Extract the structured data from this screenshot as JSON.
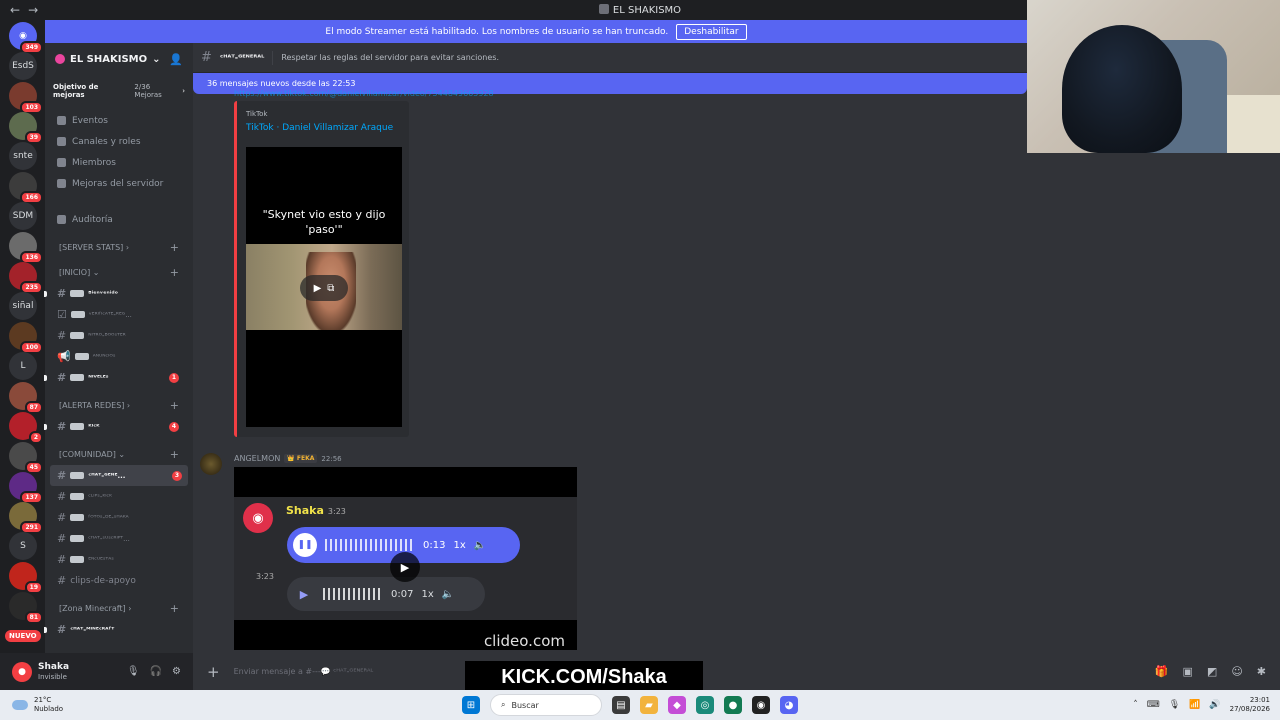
{
  "window": {
    "title": "EL SHAKISMO",
    "back": "←",
    "forward": "→"
  },
  "banner": {
    "text": "El modo Streamer está habilitado. Los nombres de usuario se han truncado.",
    "button": "Deshabilitar"
  },
  "rail": {
    "items": [
      {
        "kind": "icon",
        "label": "",
        "badge": "349"
      },
      {
        "kind": "text",
        "label": "EsdS",
        "badge": ""
      },
      {
        "kind": "img",
        "label": "",
        "badge": "103"
      },
      {
        "kind": "img",
        "label": "",
        "badge": "39"
      },
      {
        "kind": "text",
        "label": "snte",
        "badge": ""
      },
      {
        "kind": "img",
        "label": "",
        "badge": "166"
      },
      {
        "kind": "text",
        "label": "SDM",
        "badge": ""
      },
      {
        "kind": "img",
        "label": "",
        "badge": "136"
      },
      {
        "kind": "img",
        "label": "",
        "badge": "235"
      },
      {
        "kind": "text",
        "label": "siñal",
        "badge": ""
      },
      {
        "kind": "img",
        "label": "",
        "badge": "100"
      },
      {
        "kind": "text",
        "label": "L",
        "badge": ""
      },
      {
        "kind": "img",
        "label": "",
        "badge": "87"
      },
      {
        "kind": "img",
        "label": "",
        "badge": "2"
      },
      {
        "kind": "img",
        "label": "",
        "badge": "45"
      },
      {
        "kind": "img",
        "label": "",
        "badge": "137"
      },
      {
        "kind": "img",
        "label": "",
        "badge": "291"
      },
      {
        "kind": "text",
        "label": "S",
        "badge": ""
      },
      {
        "kind": "img",
        "label": "",
        "badge": "19"
      },
      {
        "kind": "img",
        "label": "",
        "badge": "81"
      }
    ],
    "new_label": "NUEVO"
  },
  "server": {
    "name": "EL SHAKISMO",
    "boost_label": "Objetivo de mejoras",
    "boost_count": "2/36 Mejoras",
    "links": [
      "Eventos",
      "Canales y roles",
      "Miembros",
      "Mejoras del servidor"
    ],
    "audit": "Auditoría"
  },
  "categories": {
    "server_stats": "[SERVER STATS]",
    "inicio": "[INICIO]",
    "alerta": "[ALERTA REDES]",
    "comunidad": "[COMUNIDAD]",
    "minecraft": "[Zona Minecraft]"
  },
  "channels": {
    "bienvenido": {
      "name": "ᴮⁱᵉⁿᵛᵉⁿⁱᵈᵒ",
      "badge": ""
    },
    "verificate": {
      "name": "ᵛᴱᴿᴵᶠᴵᶜᴬᵀᴱ-ᴿᴱᴳ...",
      "badge": ""
    },
    "nitro": {
      "name": "ᴺᴵᵀᴿᴼ-ᴮᴼᴼˢᵀᴱᴿ",
      "badge": ""
    },
    "anuncios": {
      "name": "ᴬᴺᵁᴺᶜᴵᴼˢ",
      "badge": ""
    },
    "niveles": {
      "name": "ᴺᴵⱽᴱᴸᴱˢ",
      "badge": "1"
    },
    "kick": {
      "name": "ᴷᴵᶜᴷ",
      "badge": "4"
    },
    "chat_general": {
      "name": "ᶜᴴᴬᵀ-ᴳᴱᴺᴱ...",
      "badge": "3"
    },
    "clips_kick": {
      "name": "ᶜᴸᴵᴾˢ-ᴷᴵᶜᴷ",
      "badge": ""
    },
    "fotos": {
      "name": "ᶠᴼᵀᴼˢ-ᴰᴱ-ˢᴴᴬᴷᴬ",
      "badge": ""
    },
    "chat_suscript": {
      "name": "ᶜᴴᴬᵀ-ˢᵁˢᶜᴿᴵᴾᵀ...",
      "badge": ""
    },
    "encuestas": {
      "name": "ᴱᴺᶜᵁᴱˢᵀᴬˢ",
      "badge": ""
    },
    "clips_apoyo": {
      "name": "clips-de-apoyo",
      "badge": ""
    },
    "chat_minecraft": {
      "name": "ᶜᴴᴬᵀ-ᴹᴵᴺᴱᶜᴿᴬᶠᵀ",
      "badge": ""
    }
  },
  "user": {
    "name": "Shaka",
    "status": "Invisible"
  },
  "header": {
    "channel": "ᶜᴴᴬᵀ-ᴳᴱᴺᴱᴿᴬᴸ",
    "topic": "Respetar las reglas del servidor para evitar sanciones."
  },
  "new_messages": "36 mensajes nuevos desde las 22:53",
  "embed": {
    "url": "https://www.tiktok.com/@danielvillamizar/video/7544849665928",
    "provider": "TikTok",
    "title": "TikTok · Daniel Villamizar Araque",
    "caption": "\"Skynet vio esto y dijo 'paso'\""
  },
  "message2": {
    "author": "ANGELMON",
    "tag": "FEKA",
    "time": "22:56",
    "video": {
      "sender": "Shaka",
      "sender_time": "3:23",
      "vm1_time": "0:13",
      "vm1_speed": "1x",
      "side_time": "3:23",
      "vm2_time": "0:07",
      "vm2_speed": "1x",
      "watermark": "clideo.com"
    }
  },
  "composer": {
    "placeholder": "Enviar mensaje a #---💬 ᶜᴴᴬᵀ-ᴳᴱᴺᴱᴿᴬᴸ"
  },
  "overlay": {
    "kick": "KICK.COM/Shaka"
  },
  "taskbar": {
    "temp": "21°C",
    "weather": "Nublado",
    "search": "Buscar",
    "time": "23:01",
    "date": "27/08/2026"
  }
}
